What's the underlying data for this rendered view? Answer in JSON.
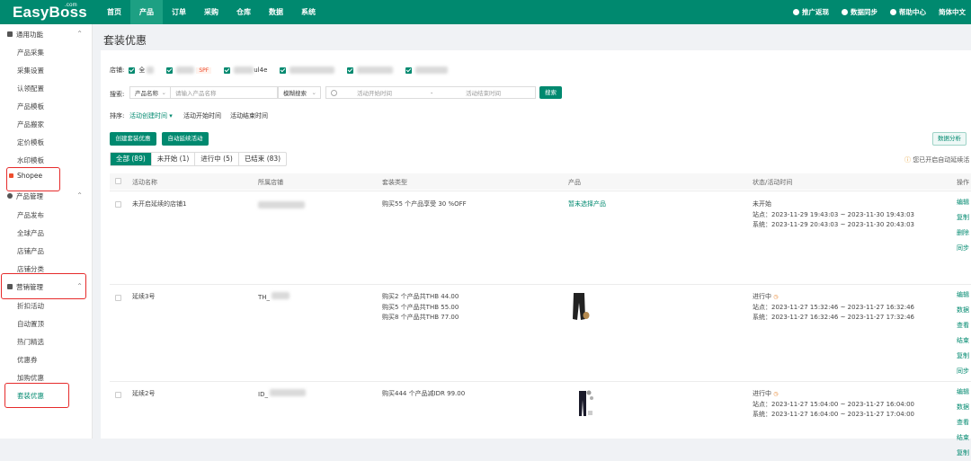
{
  "topbar": {
    "logo": "EasyBoss",
    "logo_com": ".com",
    "nav": [
      "首页",
      "产品",
      "订单",
      "采购",
      "仓库",
      "数据",
      "系统"
    ],
    "right": [
      "推广返现",
      "数据同步",
      "帮助中心",
      "简体中文"
    ]
  },
  "sidebar": {
    "g1": "通用功能",
    "g1_items": [
      "产品采集",
      "采集设置",
      "认领配置",
      "产品模板",
      "产品搬家",
      "定价模板",
      "水印模板"
    ],
    "shopee": "Shopee",
    "g2": "产品管理",
    "g2_items": [
      "产品发布",
      "全球产品",
      "店铺产品",
      "店铺分类"
    ],
    "g3": "营销管理",
    "g3_items": [
      "折扣活动",
      "自动置顶",
      "热门精选",
      "优惠券",
      "加购优惠",
      "套装优惠"
    ]
  },
  "page": {
    "title": "套装优惠"
  },
  "filters": {
    "store_label": "店铺:",
    "store_all": "全",
    "store_tag": "SPF",
    "store_suffix": "ul4e",
    "search_label": "搜索:",
    "search_field": "产品名称",
    "search_placeholder": "请输入产品名称",
    "search_mode": "模糊搜索",
    "start_placeholder": "活动开始时间",
    "end_placeholder": "活动结束时间",
    "range_sep": "-",
    "search_button": "搜索",
    "sort_label": "排序:",
    "sort_options": [
      "活动创建时间",
      "活动开始时间",
      "活动结束时间"
    ]
  },
  "actions": {
    "create": "创建套装优惠",
    "auto": "自动延续活动",
    "analysis": "数据分析",
    "notice": "您已开启自动延续活"
  },
  "tabs": [
    {
      "label": "全部 (89)"
    },
    {
      "label": "未开始 (1)"
    },
    {
      "label": "进行中 (5)"
    },
    {
      "label": "已结束 (83)"
    }
  ],
  "table": {
    "headers": [
      "活动名称",
      "所属店铺",
      "套装类型",
      "产品",
      "状态/活动时间",
      "操作"
    ],
    "rows": [
      {
        "name": "未开启延续的店铺1",
        "store": "",
        "types": [
          "购买55 个产品享受 30 %OFF"
        ],
        "product": "暂未选择产品",
        "status": "未开始",
        "site": "站点：2023-11-29 19:43:03 ~ 2023-11-30 19:43:03",
        "system": "系统：2023-11-29 20:43:03 ~ 2023-11-30 20:43:03",
        "ops": [
          "编辑",
          "复制",
          "删除",
          "同步"
        ]
      },
      {
        "name": "延续3号",
        "store": "TH_",
        "types": [
          "购买2 个产品共THB 44.00",
          "购买5 个产品共THB 55.00",
          "购买8 个产品共THB 77.00"
        ],
        "product": "",
        "status": "进行中",
        "site": "站点：2023-11-27 15:32:46 ~ 2023-11-27 16:32:46",
        "system": "系统：2023-11-27 16:32:46 ~ 2023-11-27 17:32:46",
        "ops": [
          "编辑",
          "数据",
          "查看",
          "结束",
          "复制",
          "同步"
        ]
      },
      {
        "name": "延续2号",
        "store": "ID_",
        "types": [
          "购买444 个产品减IDR 99.00"
        ],
        "product": "",
        "status": "进行中",
        "site": "站点：2023-11-27 15:04:00 ~ 2023-11-27 16:04:00",
        "system": "系统：2023-11-27 16:04:00 ~ 2023-11-27 17:04:00",
        "ops": [
          "编辑",
          "数据",
          "查看",
          "结束",
          "复制"
        ]
      }
    ]
  }
}
